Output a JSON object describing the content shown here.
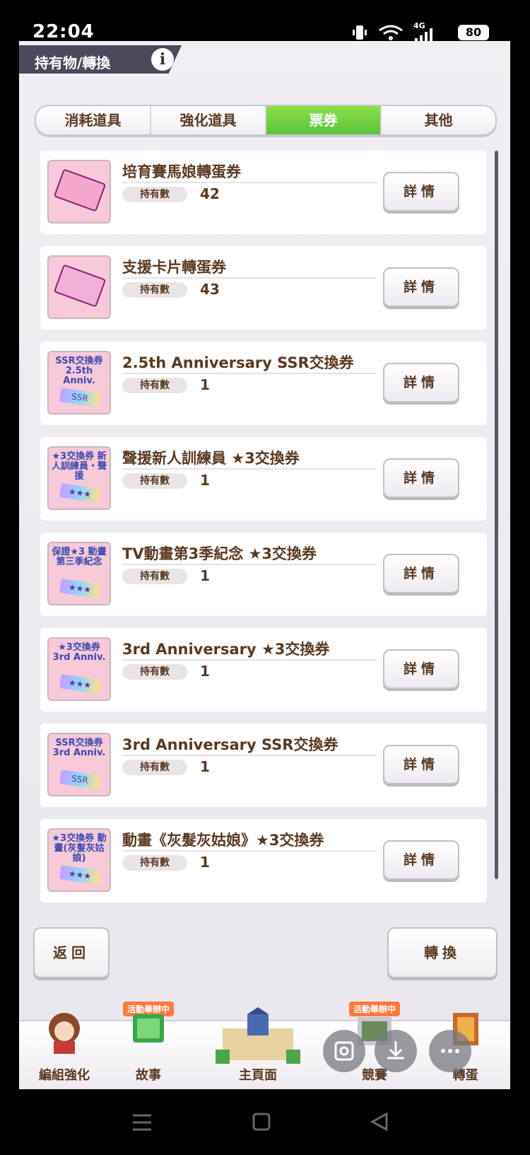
{
  "status_bar": {
    "time": "22:04",
    "battery": "80",
    "network": "4G"
  },
  "header": {
    "title": "持有物/轉換",
    "info_label": "i"
  },
  "tabs": [
    {
      "label": "消耗道具",
      "active": false
    },
    {
      "label": "強化道具",
      "active": false
    },
    {
      "label": "票券",
      "active": true
    },
    {
      "label": "其他",
      "active": false
    }
  ],
  "owned_label": "持有數",
  "detail_label": "詳情",
  "items": [
    {
      "name": "培育賽馬娘轉蛋券",
      "count": "42",
      "thumb_text": ""
    },
    {
      "name": "支援卡片轉蛋券",
      "count": "43",
      "thumb_text": ""
    },
    {
      "name": "2.5th Anniversary SSR交換券",
      "count": "1",
      "thumb_text": "SSR交換券 2.5th Anniv."
    },
    {
      "name": "聲援新人訓練員 ★3交換券",
      "count": "1",
      "thumb_text": "★3交換券 新人訓練員・聲援"
    },
    {
      "name": "TV動畫第3季紀念 ★3交換券",
      "count": "1",
      "thumb_text": "保證★3 動畫第三季紀念"
    },
    {
      "name": "3rd Anniversary ★3交換券",
      "count": "1",
      "thumb_text": "★3交換券 3rd Anniv."
    },
    {
      "name": "3rd Anniversary SSR交換券",
      "count": "1",
      "thumb_text": "SSR交換券 3rd Anniv."
    },
    {
      "name": "動畫《灰髮灰姑娘》★3交換券",
      "count": "1",
      "thumb_text": "★3交換券 動畫(灰髮灰姑娘)"
    }
  ],
  "buttons": {
    "back": "返回",
    "convert": "轉換"
  },
  "bottom_nav": [
    {
      "label": "編組強化",
      "badge": ""
    },
    {
      "label": "故事",
      "badge": "活動舉辦中"
    },
    {
      "label": "主頁面",
      "badge": ""
    },
    {
      "label": "競賽",
      "badge": "活動舉辦中"
    },
    {
      "label": "轉蛋",
      "badge": ""
    }
  ],
  "colors": {
    "accent_green": "#5cc23a",
    "text_brown": "#5a3a22",
    "header_bg": "#4a4a5c"
  }
}
